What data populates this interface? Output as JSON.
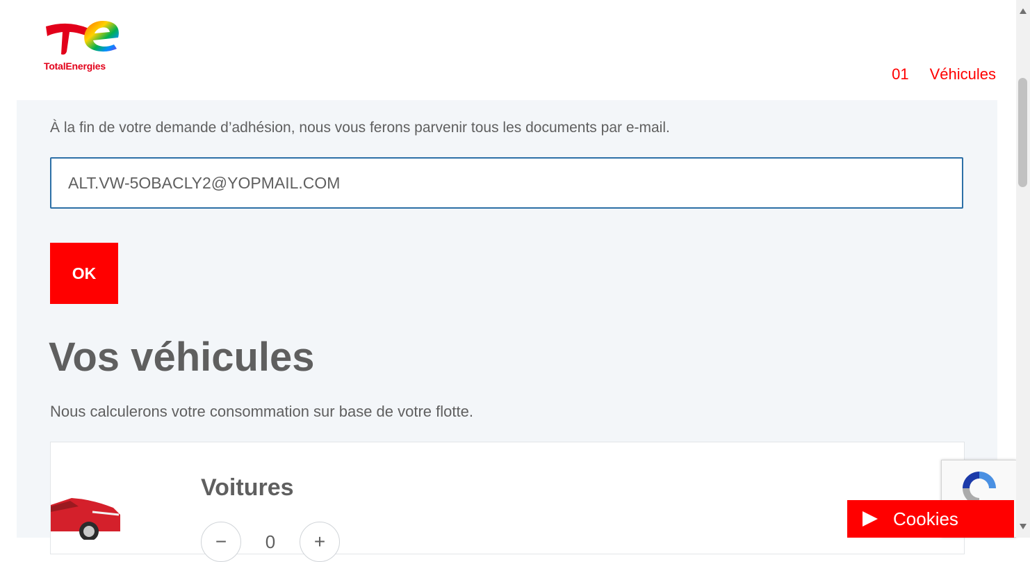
{
  "header": {
    "logo_text": "TotalEnergies",
    "steps": [
      {
        "label": "01"
      },
      {
        "label": "Véhicules"
      }
    ]
  },
  "email_section": {
    "intro_text": "À la fin de votre demande d’adhésion, nous vous ferons parvenir tous les documents par e-mail.",
    "email_value": "ALT.VW-5OBACLY2@YOPMAIL.COM",
    "ok_label": "OK"
  },
  "vehicles_section": {
    "title": "Vos véhicules",
    "subtitle": "Nous calculerons votre consommation sur base de votre flotte.",
    "cards": [
      {
        "title": "Voitures",
        "count": "0",
        "minus": "−",
        "plus": "+"
      }
    ]
  },
  "cookies": {
    "label": "Cookies"
  },
  "colors": {
    "brand_red": "#ff0000",
    "panel_bg": "#f3f6f9",
    "input_border": "#2c6fa6"
  }
}
